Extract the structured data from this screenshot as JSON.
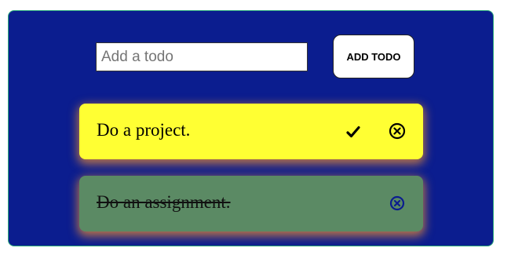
{
  "input": {
    "placeholder": "Add a todo",
    "value": ""
  },
  "add_button": {
    "label": "ADD TODO"
  },
  "todos": [
    {
      "text": "Do a project.",
      "completed": false,
      "color": "#ffff33",
      "icons": [
        "check-icon",
        "remove-icon"
      ]
    },
    {
      "text": "Do an assignment.",
      "completed": true,
      "color": "#5b8a64",
      "icons": [
        "remove-icon"
      ]
    }
  ],
  "colors": {
    "background": "#0b1d8f",
    "border": "#2aa87a",
    "shadow": "#d6823c"
  }
}
